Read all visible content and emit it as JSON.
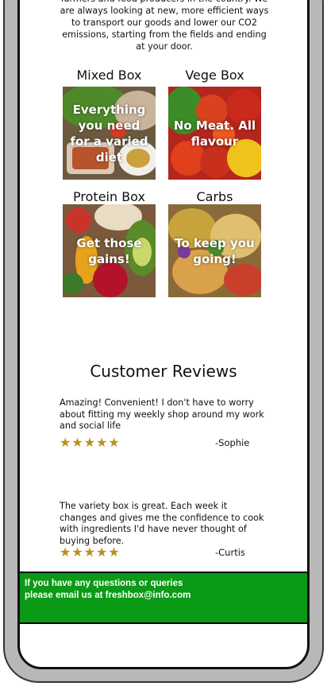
{
  "intro": {
    "text": "the world so we only use sustainable, ethical farmers and food producers in the country. We are always looking at new, more efficient ways to transport our goods and lower our CO2 emissions, starting from the fields and ending at your door."
  },
  "boxes": [
    {
      "title": "Mixed Box",
      "overlay": "Everything you need for a varied diet"
    },
    {
      "title": "Vege Box",
      "overlay": "No Meat. All flavour"
    },
    {
      "title": "Protein Box",
      "overlay": "Get those gains!"
    },
    {
      "title": "Carbs",
      "overlay": "To keep you going!"
    }
  ],
  "reviews": {
    "title": "Customer Reviews",
    "items": [
      {
        "text": "Amazing! Convenient! I don't have to worry about fitting my weekly shop around my work and social life",
        "author": "-Sophie",
        "rating": 5
      },
      {
        "text": "The variety box is great. Each week it changes and gives me the confidence to cook with ingredients I'd have never thought of buying before.",
        "author": "-Curtis",
        "rating": 5
      }
    ]
  },
  "footer": {
    "text": "If you have any questions or queries please email us at freshbox@info.com"
  },
  "colors": {
    "footer_bg": "#0a9a16",
    "star": "#b8901c",
    "frame": "#b8b8b8"
  },
  "icons": {
    "star": "star-icon"
  }
}
